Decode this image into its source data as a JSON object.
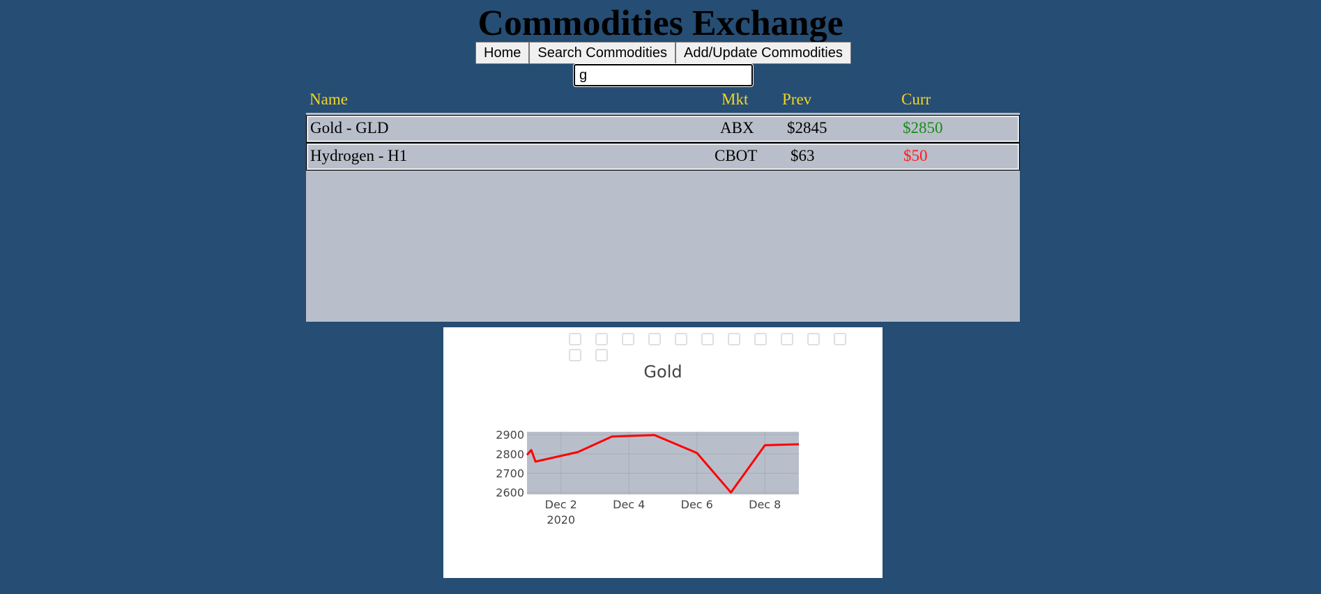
{
  "header": {
    "title": "Commodities Exchange"
  },
  "nav": {
    "home": "Home",
    "search": "Search Commodities",
    "add_update": "Add/Update Commodities"
  },
  "search": {
    "value": "g",
    "placeholder": ""
  },
  "table": {
    "columns": [
      "Name",
      "Mkt",
      "Prev",
      "Curr"
    ],
    "rows": [
      {
        "name": "Gold - GLD",
        "mkt": "ABX",
        "prev": "$2845",
        "curr": "$2850",
        "curr_color": "#1a8a1a"
      },
      {
        "name": "Hydrogen - H1",
        "mkt": "CBOT",
        "prev": "$63",
        "curr": "$50",
        "curr_color": "#ff1a1a"
      }
    ]
  },
  "chart": {
    "title": "Gold",
    "icons": [
      "camera-icon",
      "zoom-icon",
      "pan-icon",
      "box-select-icon",
      "lasso-icon",
      "zoom-in-icon",
      "zoom-out-icon",
      "autoscale-icon",
      "reset-axes-icon",
      "spike-lines-icon",
      "hover-closest-icon",
      "hover-compare-icon",
      "plotly-logo-icon"
    ]
  },
  "chart_data": {
    "type": "line",
    "title": "Gold",
    "xlabel": "",
    "ylabel": "",
    "x": [
      "2020-12-01 00:00",
      "2020-12-01 03:00",
      "2020-12-01 06:00",
      "2020-12-02 12:00",
      "2020-12-03 12:00",
      "2020-12-04 18:00",
      "2020-12-06 00:00",
      "2020-12-07 00:00",
      "2020-12-07 24:00",
      "2020-12-09 00:00"
    ],
    "series": [
      {
        "values": [
          2795,
          2820,
          2760,
          2810,
          2890,
          2898,
          2805,
          2600,
          2845,
          2850
        ],
        "color": "#ff0000"
      }
    ],
    "x_ticks": [
      {
        "label": "Dec 2",
        "sublabel": "2020",
        "x": "2020-12-02"
      },
      {
        "label": "Dec 4",
        "sublabel": "",
        "x": "2020-12-04"
      },
      {
        "label": "Dec 6",
        "sublabel": "",
        "x": "2020-12-06"
      },
      {
        "label": "Dec 8",
        "sublabel": "",
        "x": "2020-12-08"
      }
    ],
    "y_ticks": [
      2600,
      2700,
      2800,
      2900
    ],
    "xlim": [
      "2020-12-01",
      "2020-12-09"
    ],
    "ylim": [
      2590,
      2915
    ],
    "grid": true,
    "plot_bg": "#b9bfca"
  }
}
